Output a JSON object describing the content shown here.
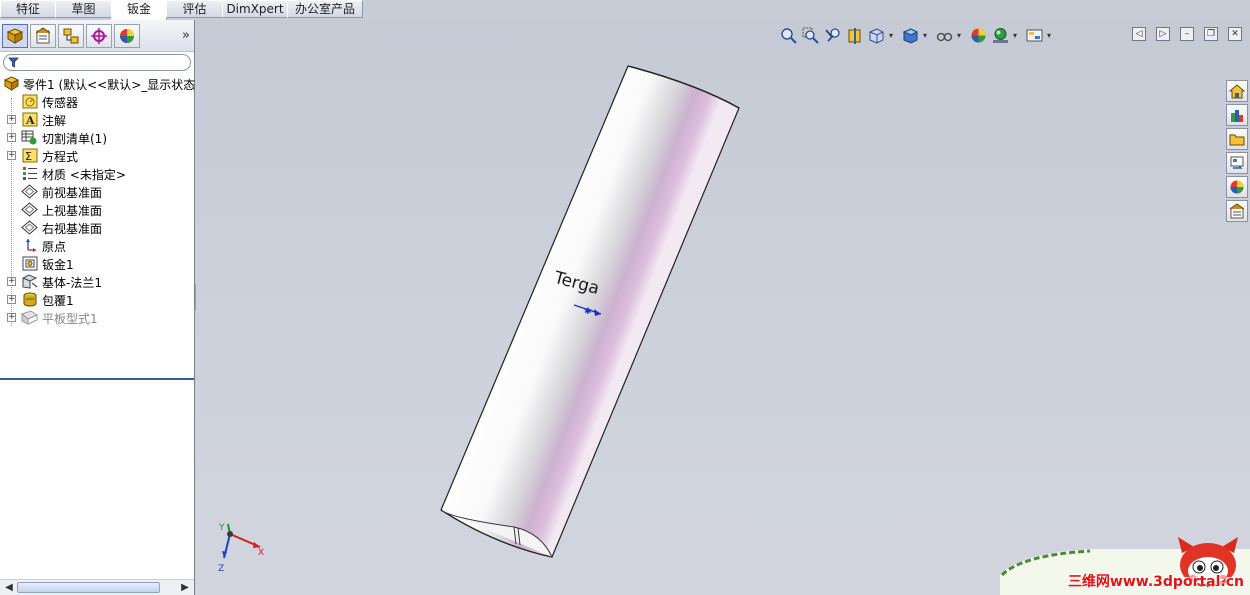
{
  "tabs": [
    {
      "label": "特征",
      "width": 56
    },
    {
      "label": "草图",
      "width": 57
    },
    {
      "label": "钣金",
      "width": 56,
      "active": true
    },
    {
      "label": "评估",
      "width": 57
    },
    {
      "label": "DimXpert",
      "width": 66
    },
    {
      "label": "办公室产品",
      "width": 76
    }
  ],
  "panel": {
    "more_label": "»",
    "tabs": [
      "featuremanager-icon",
      "propertymanager-icon",
      "configurationmanager-icon",
      "dimxpert-manager-icon",
      "display-manager-icon"
    ]
  },
  "tree": {
    "root": {
      "label": "零件1  (默认<<默认>_显示状态",
      "icon": "part-icon"
    },
    "items": [
      {
        "label": "传感器",
        "icon": "sensor-icon",
        "expandable": false
      },
      {
        "label": "注解",
        "icon": "annotation-icon",
        "expandable": true
      },
      {
        "label": "切割清单(1)",
        "icon": "cut-list-icon",
        "expandable": true
      },
      {
        "label": "方程式",
        "icon": "equation-icon",
        "expandable": true
      },
      {
        "label": "材质 <未指定>",
        "icon": "material-icon",
        "expandable": false
      },
      {
        "label": "前视基准面",
        "icon": "plane-icon",
        "expandable": false
      },
      {
        "label": "上视基准面",
        "icon": "plane-icon",
        "expandable": false
      },
      {
        "label": "右视基准面",
        "icon": "plane-icon",
        "expandable": false
      },
      {
        "label": "原点",
        "icon": "origin-icon",
        "expandable": false
      },
      {
        "label": "钣金1",
        "icon": "sheet-metal-icon",
        "expandable": false
      },
      {
        "label": "基体-法兰1",
        "icon": "base-flange-icon",
        "expandable": true
      },
      {
        "label": "包覆1",
        "icon": "wrap-icon",
        "expandable": true
      },
      {
        "label": "平板型式1",
        "icon": "flat-pattern-icon",
        "expandable": true,
        "suppressed": true
      }
    ]
  },
  "model": {
    "label": "Terga"
  },
  "triad": {
    "x": "X",
    "y": "Y",
    "z": "Z"
  },
  "watermark": {
    "text": "三维网www.3dportal.cn"
  },
  "colors": {
    "viewport": "#c9cdd7",
    "tube_tint": "#d9bdd9",
    "accent_blue": "#2f5ea9",
    "watermark_red": "#e41414"
  }
}
